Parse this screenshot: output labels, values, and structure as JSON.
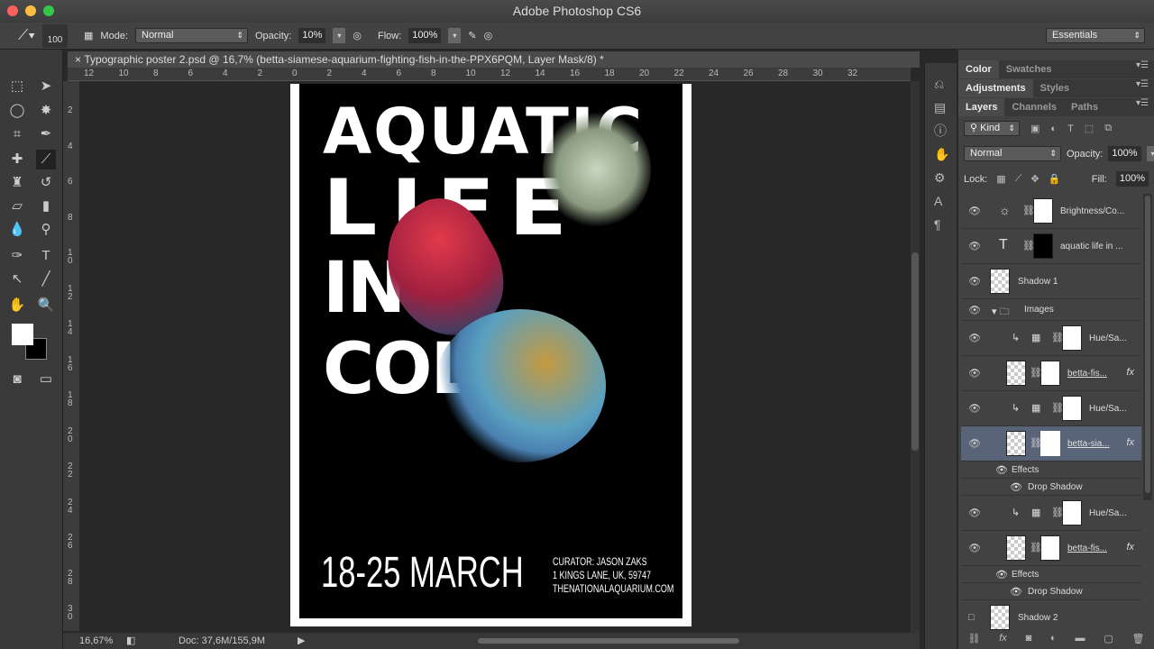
{
  "app": {
    "title": "Adobe Photoshop CS6"
  },
  "options": {
    "brush_size": "100",
    "mode_label": "Mode:",
    "mode": "Normal",
    "opacity_label": "Opacity:",
    "opacity": "10%",
    "flow_label": "Flow:",
    "flow": "100%",
    "workspace": "Essentials"
  },
  "document": {
    "tab": "Typographic poster 2.psd @ 16,7% (betta-siamese-aquarium-fighting-fish-in-the-PPX6PQM, Layer Mask/8) *",
    "ruler_h": [
      "12",
      "10",
      "8",
      "6",
      "4",
      "2",
      "0",
      "2",
      "4",
      "6",
      "8",
      "10",
      "12",
      "14",
      "16",
      "18",
      "20",
      "22",
      "24",
      "26",
      "28",
      "30",
      "32"
    ],
    "ruler_v": [
      "2",
      "4",
      "6",
      "8",
      "1 0",
      "1 2",
      "1 4",
      "1 6",
      "1 8",
      "2 0",
      "2 2",
      "2 4",
      "2 6",
      "2 8",
      "3 0"
    ]
  },
  "poster": {
    "line1": "AQUATIC",
    "line2": "LIFE",
    "line3": "IN COLOR",
    "date": "18-25 MARCH",
    "info": [
      "CURATOR: JASON ZAKS",
      "1 KINGS LANE, UK, 59747",
      "THENATIONALAQUARIUM.COM"
    ]
  },
  "status": {
    "zoom": "16,67%",
    "doc": "Doc: 37,6M/155,9M"
  },
  "panels": {
    "tabs1": [
      "Color",
      "Swatches"
    ],
    "tabs2": [
      "Adjustments",
      "Styles"
    ],
    "tabs3": [
      "Layers",
      "Channels",
      "Paths"
    ],
    "kind": "Kind",
    "blend": "Normal",
    "opacity_label": "Opacity:",
    "opacity": "100%",
    "lock_label": "Lock:",
    "fill_label": "Fill:",
    "fill": "100%"
  },
  "layers": [
    {
      "name": "Brightness/Co...",
      "kind": "adjust"
    },
    {
      "name": "aquatic life  in ...",
      "kind": "text"
    },
    {
      "name": "Shadow 1",
      "kind": "pixel"
    },
    {
      "name": "Images",
      "kind": "group"
    },
    {
      "name": "Hue/Sa...",
      "kind": "adjust-clip"
    },
    {
      "name": "betta-fis...",
      "kind": "masked"
    },
    {
      "name": "Hue/Sa...",
      "kind": "adjust-clip"
    },
    {
      "name": "betta-sia...",
      "kind": "masked",
      "selected": true
    },
    {
      "name": "Effects",
      "kind": "effects"
    },
    {
      "name": "Drop Shadow",
      "kind": "effect"
    },
    {
      "name": "Hue/Sa...",
      "kind": "adjust-clip"
    },
    {
      "name": "betta-fis...",
      "kind": "masked"
    },
    {
      "name": "Effects",
      "kind": "effects"
    },
    {
      "name": "Drop Shadow",
      "kind": "effect"
    },
    {
      "name": "Shadow 2",
      "kind": "pixel",
      "hidden": true
    }
  ]
}
